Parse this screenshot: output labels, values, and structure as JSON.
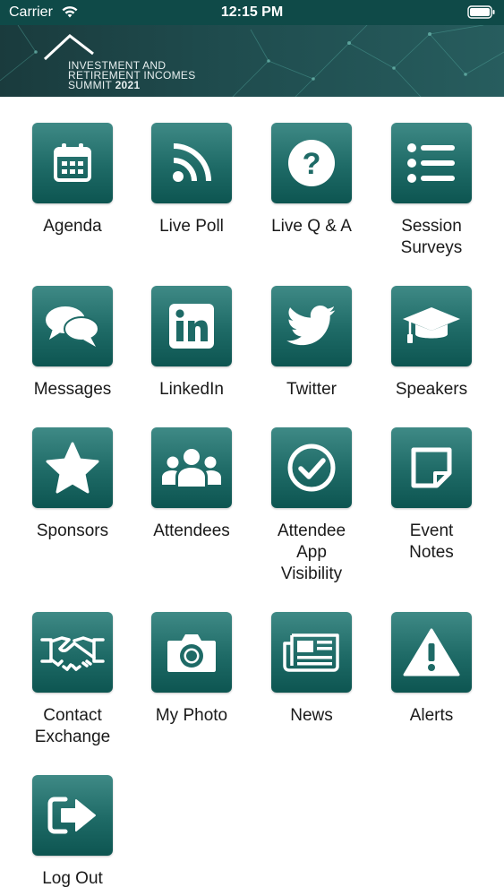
{
  "status_bar": {
    "carrier": "Carrier",
    "time": "12:15 PM"
  },
  "banner": {
    "line1": "INVESTMENT AND",
    "line2": "RETIREMENT INCOMES",
    "line3": "SUMMIT",
    "year": "2021"
  },
  "colors": {
    "tile_top": "#3f8a86",
    "tile_bottom": "#0d5551",
    "status_bar": "#0f4a48"
  },
  "tiles": [
    {
      "label": "Agenda",
      "icon": "calendar-icon"
    },
    {
      "label": "Live Poll",
      "icon": "rss-icon"
    },
    {
      "label": "Live Q & A",
      "icon": "question-icon"
    },
    {
      "label": "Session\nSurveys",
      "icon": "list-icon"
    },
    {
      "label": "Messages",
      "icon": "chat-bubbles-icon"
    },
    {
      "label": "LinkedIn",
      "icon": "linkedin-icon"
    },
    {
      "label": "Twitter",
      "icon": "twitter-icon"
    },
    {
      "label": "Speakers",
      "icon": "graduation-cap-icon"
    },
    {
      "label": "Sponsors",
      "icon": "star-icon"
    },
    {
      "label": "Attendees",
      "icon": "users-icon"
    },
    {
      "label": "Attendee\nApp\nVisibility",
      "icon": "check-circle-icon"
    },
    {
      "label": "Event\nNotes",
      "icon": "note-icon"
    },
    {
      "label": "Contact\nExchange",
      "icon": "handshake-icon"
    },
    {
      "label": "My Photo",
      "icon": "camera-icon"
    },
    {
      "label": "News",
      "icon": "newspaper-icon"
    },
    {
      "label": "Alerts",
      "icon": "alert-icon"
    },
    {
      "label": "Log Out",
      "icon": "logout-icon"
    }
  ]
}
